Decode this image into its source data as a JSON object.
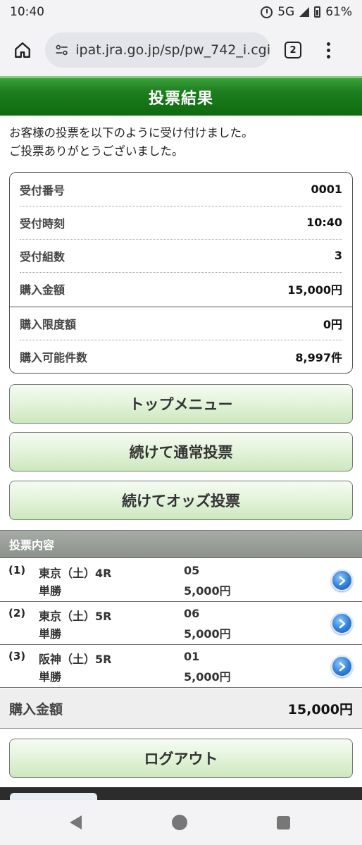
{
  "status_bar": {
    "time": "10:40",
    "network": "5G",
    "battery": "61%"
  },
  "browser": {
    "url": "ipat.jra.go.jp/sp/pw_742_i.cgi",
    "tab_count": "2"
  },
  "header": {
    "title": "投票結果"
  },
  "intro": {
    "line1": "お客様の投票を以下のように受け付けました。",
    "line2": "ご投票ありがとうございました。"
  },
  "receipt": [
    {
      "label": "受付番号",
      "value": "0001"
    },
    {
      "label": "受付時刻",
      "value": "10:40"
    },
    {
      "label": "受付組数",
      "value": "3"
    },
    {
      "label": "購入金額",
      "value": "15,000円"
    },
    {
      "label": "購入限度額",
      "value": "0円"
    },
    {
      "label": "購入可能件数",
      "value": "8,997件"
    }
  ],
  "buttons": {
    "top_menu": "トップメニュー",
    "continue_normal": "続けて通常投票",
    "continue_odds": "続けてオッズ投票",
    "logout": "ログアウト"
  },
  "bets": {
    "section_title": "投票内容",
    "items": [
      {
        "no": "(1)",
        "race": "東京（土）4R",
        "type": "単勝",
        "horse": "05",
        "amount": "5,000円"
      },
      {
        "no": "(2)",
        "race": "東京（土）5R",
        "type": "単勝",
        "horse": "06",
        "amount": "5,000円"
      },
      {
        "no": "(3)",
        "race": "阪神（土）5R",
        "type": "単勝",
        "horse": "01",
        "amount": "5,000円"
      }
    ],
    "total_label": "購入金額",
    "total_value": "15,000円"
  },
  "icons": {
    "status": [
      "alarm-icon",
      "signal-icon",
      "battery-icon"
    ],
    "browser": [
      "home-icon",
      "tune-icon",
      "tabs-icon",
      "menu-icon"
    ],
    "bet_row": "chevron-right-icon",
    "nav": [
      "back-icon",
      "home-circle-icon",
      "recent-apps-icon"
    ]
  },
  "colors": {
    "header_green": "#1e7f1e",
    "button_green": "#e3f3da",
    "section_gray": "#8d928d",
    "arrow_blue": "#2c7fe0"
  }
}
